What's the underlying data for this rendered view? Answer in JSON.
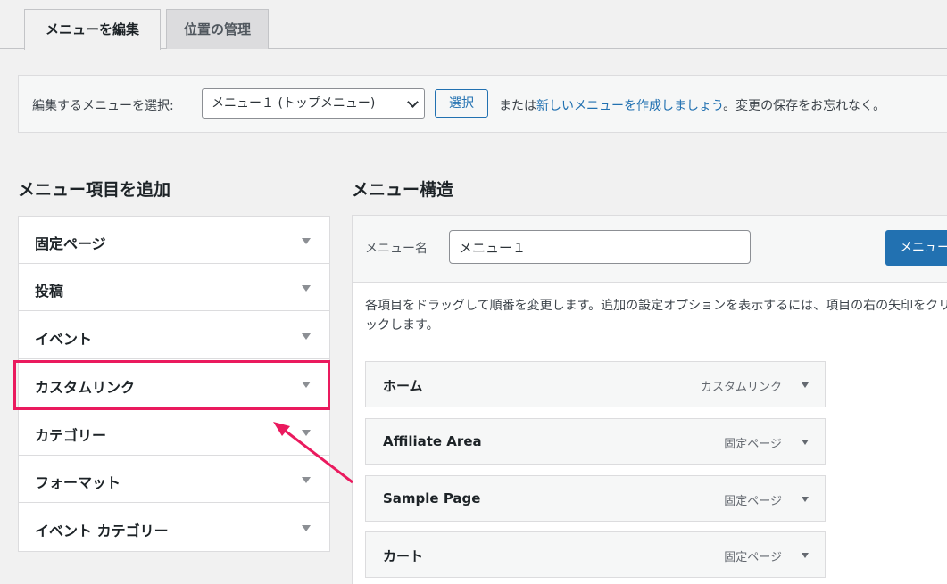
{
  "tabs": {
    "edit_menus": "メニューを編集",
    "manage_locations": "位置の管理"
  },
  "select_bar": {
    "label": "編集するメニューを選択:",
    "selected_menu": "メニュー１ (トップメニュー)",
    "select_button": "選択",
    "or_text": "または",
    "create_link": "新しいメニューを作成しましょう",
    "suffix": "。変更の保存をお忘れなく。"
  },
  "add_items": {
    "heading": "メニュー項目を追加",
    "items": [
      {
        "label": "固定ページ"
      },
      {
        "label": "投稿"
      },
      {
        "label": "イベント"
      },
      {
        "label": "カスタムリンク"
      },
      {
        "label": "カテゴリー"
      },
      {
        "label": "フォーマット"
      },
      {
        "label": "イベント カテゴリー"
      }
    ]
  },
  "structure": {
    "heading": "メニュー構造",
    "name_label": "メニュー名",
    "name_value": "メニュー１",
    "save_button": "メニュー",
    "instructions": "各項目をドラッグして順番を変更します。追加の設定オプションを表示するには、項目の右の矢印をクリックします。",
    "items": [
      {
        "title": "ホーム",
        "type": "カスタムリンク"
      },
      {
        "title": "Affiliate Area",
        "type": "固定ページ"
      },
      {
        "title": "Sample Page",
        "type": "固定ページ"
      },
      {
        "title": "カート",
        "type": "固定ページ"
      }
    ]
  },
  "colors": {
    "highlight": "#ea1a5e",
    "accent": "#2271b1"
  }
}
